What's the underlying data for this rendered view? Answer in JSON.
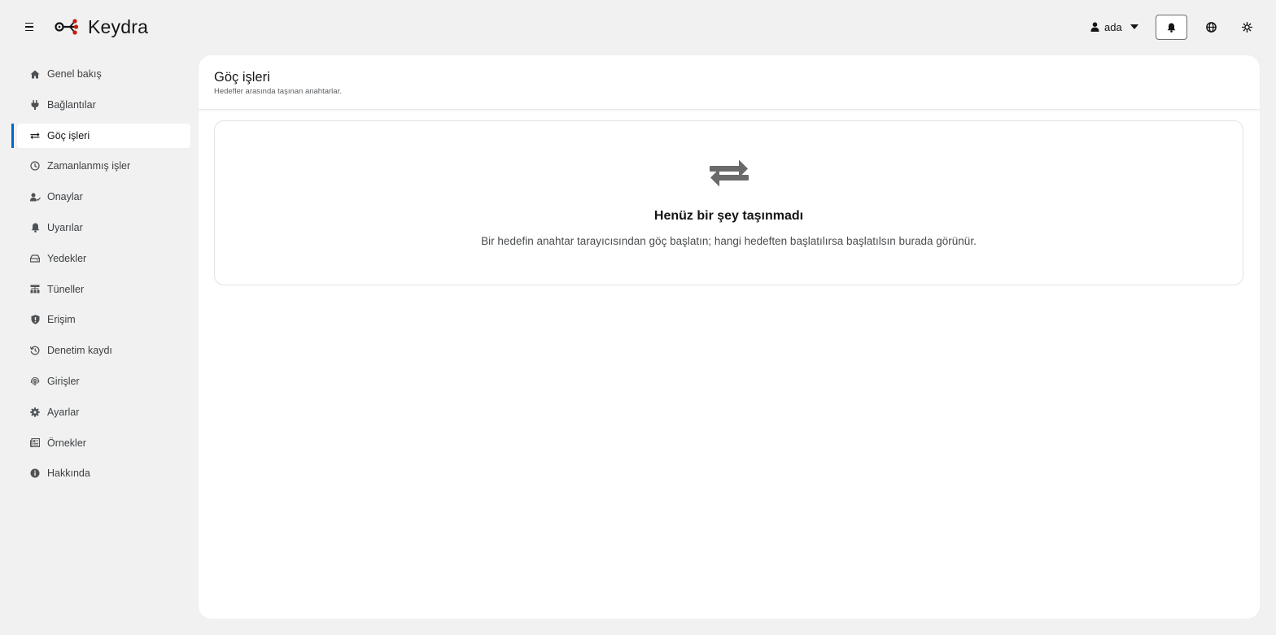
{
  "app": {
    "name": "Keydra"
  },
  "header": {
    "user_name": "ada"
  },
  "sidebar": {
    "items": [
      {
        "label": "Genel bakış",
        "icon": "home-icon",
        "active": false
      },
      {
        "label": "Bağlantılar",
        "icon": "plug-icon",
        "active": false
      },
      {
        "label": "Göç işleri",
        "icon": "exchange-icon",
        "active": true
      },
      {
        "label": "Zamanlanmış işler",
        "icon": "clock-icon",
        "active": false
      },
      {
        "label": "Onaylar",
        "icon": "user-check-icon",
        "active": false
      },
      {
        "label": "Uyarılar",
        "icon": "bell-icon",
        "active": false
      },
      {
        "label": "Yedekler",
        "icon": "hard-drive-icon",
        "active": false
      },
      {
        "label": "Tüneller",
        "icon": "network-icon",
        "active": false
      },
      {
        "label": "Erişim",
        "icon": "shield-icon",
        "active": false
      },
      {
        "label": "Denetim kaydı",
        "icon": "history-icon",
        "active": false
      },
      {
        "label": "Girişler",
        "icon": "fingerprint-icon",
        "active": false
      },
      {
        "label": "Ayarlar",
        "icon": "gear-icon",
        "active": false
      },
      {
        "label": "Örnekler",
        "icon": "newspaper-icon",
        "active": false
      },
      {
        "label": "Hakkında",
        "icon": "info-icon",
        "active": false
      }
    ]
  },
  "page": {
    "title": "Göç işleri",
    "subtitle": "Hedefler arasında taşınan anahtarlar."
  },
  "empty_state": {
    "icon": "exchange-icon",
    "title": "Henüz bir şey taşınmadı",
    "body": "Bir hedefin anahtar tarayıcısından göç başlatın; hangi hedeften başlatılırsa başlatılsın burada görünür."
  },
  "colors": {
    "accent": "#0066cc",
    "logo_red": "#c9190b"
  }
}
